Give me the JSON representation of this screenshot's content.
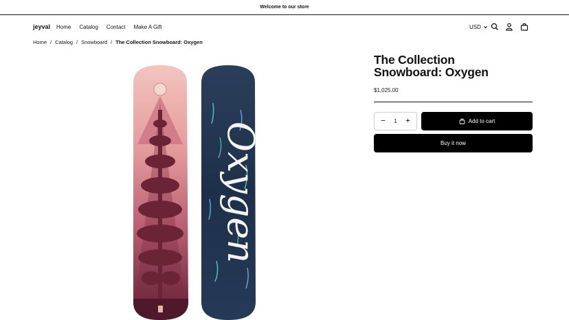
{
  "announcement": {
    "text": "Welcome to our store"
  },
  "header": {
    "logo": "jeyval",
    "nav": [
      "Home",
      "Catalog",
      "Contact",
      "Make A Gift"
    ],
    "currency": "USD",
    "icons": [
      "search-icon",
      "account-icon",
      "cart-bag-icon"
    ]
  },
  "breadcrumb": {
    "items": [
      "Home",
      "Catalog",
      "Snowboard"
    ],
    "current": "The Collection Snowboard: Oxygen",
    "separator": "/"
  },
  "product": {
    "title_line1": "The Collection",
    "title_line2": "Snowboard: Oxygen",
    "price": "$1,025.00",
    "quantity": "1",
    "add_to_cart_label": "Add to cart",
    "buy_now_label": "Buy it now",
    "board_graphic_text": "Oxygen"
  },
  "colors": {
    "text": "#121212",
    "button_bg": "#000000",
    "button_text": "#ffffff",
    "board_pink": "#e9aaa6",
    "board_maroon": "#6b2336",
    "board_navy": "#1f3148"
  }
}
